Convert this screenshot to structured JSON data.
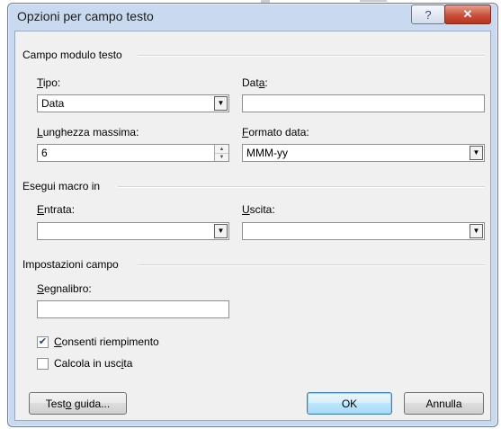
{
  "dialog": {
    "title": "Opzioni per campo testo",
    "help_label": "?",
    "close_label": "✕"
  },
  "text_field_section": {
    "heading": "Campo modulo testo",
    "type": {
      "label": "Tipo:",
      "value": "Data"
    },
    "default_date": {
      "label": "Data:",
      "value": ""
    },
    "max_length": {
      "label": "Lunghezza massima:",
      "value": "6"
    },
    "date_format": {
      "label": "Formato data:",
      "value": "MMM-yy"
    }
  },
  "macro_section": {
    "heading": "Esegui macro in",
    "entry": {
      "label": "Entrata:",
      "value": ""
    },
    "exit": {
      "label": "Uscita:",
      "value": ""
    }
  },
  "field_settings": {
    "heading": "Impostazioni campo",
    "bookmark": {
      "label": "Segnalibro:",
      "value": ""
    },
    "fill_in_enabled": {
      "label": "Consenti riempimento",
      "checked": true
    },
    "calculate_on_exit": {
      "label": "Calcola in uscita",
      "checked": false
    }
  },
  "buttons": {
    "help_text": "Testo guida...",
    "ok": "OK",
    "cancel": "Annulla"
  },
  "colors": {
    "frame": "#c9daf0",
    "close_button": "#c9503a",
    "default_button_border": "#3c7fb1"
  }
}
